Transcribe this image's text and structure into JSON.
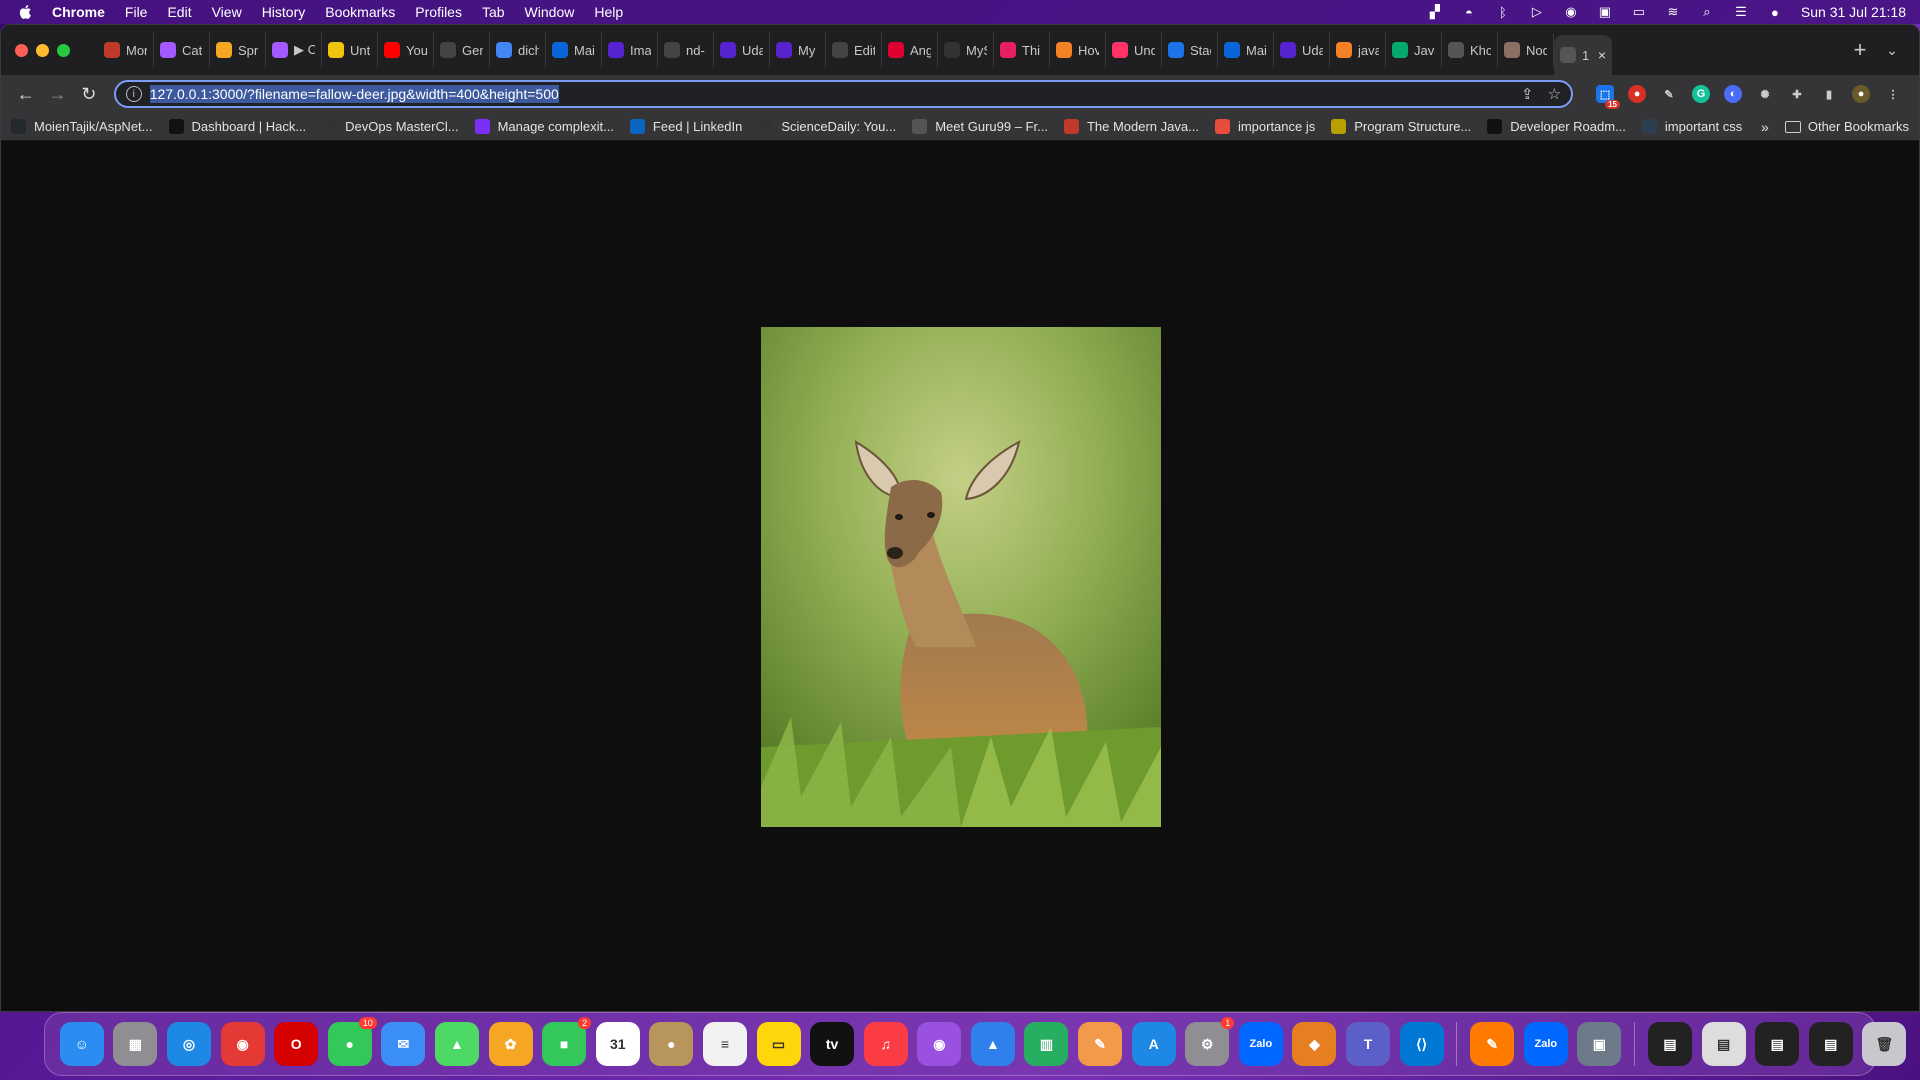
{
  "menubar": {
    "app_name": "Chrome",
    "menus": [
      "File",
      "Edit",
      "View",
      "History",
      "Bookmarks",
      "Profiles",
      "Tab",
      "Window",
      "Help"
    ],
    "clock": "Sun 31 Jul  21:18"
  },
  "tabs": [
    {
      "title": "Mon",
      "icon": "m-icon",
      "color": "#c0392b"
    },
    {
      "title": "Cat",
      "icon": "figma-icon",
      "color": "#a259ff"
    },
    {
      "title": "Spri",
      "icon": "cloud-icon",
      "color": "#f5a623"
    },
    {
      "title": "▶ C",
      "icon": "figma-icon",
      "color": "#a259ff"
    },
    {
      "title": "Unt",
      "icon": "infinity-icon",
      "color": "#f1c40f"
    },
    {
      "title": "You",
      "icon": "youtube-icon",
      "color": "#ff0000"
    },
    {
      "title": "Gen",
      "icon": "github-icon",
      "color": "#444"
    },
    {
      "title": "dich",
      "icon": "google-icon",
      "color": "#4285f4"
    },
    {
      "title": "Mai",
      "icon": "outlook-icon",
      "color": "#0a64d8"
    },
    {
      "title": "Ima",
      "icon": "udemy-icon",
      "color": "#5624d0"
    },
    {
      "title": "nd-",
      "icon": "github-icon",
      "color": "#444"
    },
    {
      "title": "Uda",
      "icon": "udemy-icon",
      "color": "#5624d0"
    },
    {
      "title": "My",
      "icon": "udemy-icon",
      "color": "#5624d0"
    },
    {
      "title": "Edit",
      "icon": "github-icon",
      "color": "#444"
    },
    {
      "title": "Ang",
      "icon": "angular-icon",
      "color": "#dd0031"
    },
    {
      "title": "MyS",
      "icon": "a-icon",
      "color": "#333"
    },
    {
      "title": "Thi",
      "icon": "t-icon",
      "color": "#e91e63"
    },
    {
      "title": "Hov",
      "icon": "stackoverflow-icon",
      "color": "#f48024"
    },
    {
      "title": "Und",
      "icon": "u-icon",
      "color": "#ff3366"
    },
    {
      "title": "Stac",
      "icon": "bolt-icon",
      "color": "#1a73e8"
    },
    {
      "title": "Mai",
      "icon": "outlook-icon",
      "color": "#0a64d8"
    },
    {
      "title": "Uda",
      "icon": "udemy-icon",
      "color": "#5624d0"
    },
    {
      "title": "java",
      "icon": "stackoverflow-icon",
      "color": "#f48024"
    },
    {
      "title": "Java",
      "icon": "w-icon",
      "color": "#04aa6d"
    },
    {
      "title": "Kho",
      "icon": "globe-icon",
      "color": "#555"
    },
    {
      "title": "Nod",
      "icon": "avatar-icon",
      "color": "#8d6e63"
    },
    {
      "title": "1",
      "icon": "globe-icon",
      "color": "#555",
      "active": true
    }
  ],
  "toolbar": {
    "url": "127.0.0.1:3000/?filename=fallow-deer.jpg&width=400&height=500"
  },
  "bookmarks": [
    {
      "label": "MoienTajik/AspNet...",
      "icon": "github-icon",
      "color": "#24292e"
    },
    {
      "label": "Dashboard | Hack...",
      "icon": "hackerrank-icon",
      "color": "#111"
    },
    {
      "label": "DevOps MasterCl...",
      "icon": "devops-icon",
      "color": "#333"
    },
    {
      "label": "Manage complexit...",
      "icon": "d-icon",
      "color": "#7b2ff7"
    },
    {
      "label": "Feed | LinkedIn",
      "icon": "linkedin-icon",
      "color": "#0a66c2"
    },
    {
      "label": "ScienceDaily: You...",
      "icon": "sd-icon",
      "color": "#333"
    },
    {
      "label": "Meet Guru99 – Fr...",
      "icon": "guru-icon",
      "color": "#555"
    },
    {
      "label": "The Modern Java...",
      "icon": "j-icon",
      "color": "#c0392b"
    },
    {
      "label": "importance js",
      "icon": "asterisk-icon",
      "color": "#e74c3c"
    },
    {
      "label": "Program Structure...",
      "icon": "ejs-icon",
      "color": "#b8a000"
    },
    {
      "label": "Developer Roadm...",
      "icon": "roadmap-icon",
      "color": "#111"
    },
    {
      "label": "important css",
      "icon": "k-icon",
      "color": "#2c3e50"
    }
  ],
  "bookmarks_more": "»",
  "other_bookmarks": "Other Bookmarks",
  "image": {
    "alt": "fallow-deer.jpg"
  },
  "dock": [
    {
      "name": "finder",
      "color": "#2b8cf2",
      "glyph": "☺"
    },
    {
      "name": "launchpad",
      "color": "#8e8e93",
      "glyph": "▦"
    },
    {
      "name": "safari",
      "color": "#1e88e5",
      "glyph": "◎"
    },
    {
      "name": "chrome",
      "color": "#e53935",
      "glyph": "◉"
    },
    {
      "name": "opera",
      "color": "#d50000",
      "glyph": "O"
    },
    {
      "name": "messages",
      "color": "#34c759",
      "glyph": "●",
      "badge": "10"
    },
    {
      "name": "mail",
      "color": "#3a8ef6",
      "glyph": "✉"
    },
    {
      "name": "maps",
      "color": "#4cd964",
      "glyph": "▲"
    },
    {
      "name": "photos",
      "color": "#f5a623",
      "glyph": "✿"
    },
    {
      "name": "facetime",
      "color": "#34c759",
      "glyph": "■",
      "badge": "2"
    },
    {
      "name": "calendar",
      "color": "#ffffff",
      "glyph": "31"
    },
    {
      "name": "contacts",
      "color": "#b8955a",
      "glyph": "●"
    },
    {
      "name": "reminders",
      "color": "#f2f2f2",
      "glyph": "≡"
    },
    {
      "name": "notes",
      "color": "#ffd60a",
      "glyph": "▭"
    },
    {
      "name": "appletv",
      "color": "#111111",
      "glyph": "tv"
    },
    {
      "name": "music",
      "color": "#fc3c44",
      "glyph": "♫"
    },
    {
      "name": "podcasts",
      "color": "#9b51e0",
      "glyph": "◉"
    },
    {
      "name": "keynote",
      "color": "#2f80ed",
      "glyph": "▲"
    },
    {
      "name": "numbers",
      "color": "#27ae60",
      "glyph": "▥"
    },
    {
      "name": "pages",
      "color": "#f2994a",
      "glyph": "✎"
    },
    {
      "name": "appstore",
      "color": "#1e88e5",
      "glyph": "A"
    },
    {
      "name": "system-preferences",
      "color": "#8e8e93",
      "glyph": "⚙",
      "badge": "1"
    },
    {
      "name": "zalo",
      "color": "#0068ff",
      "glyph": "Zalo"
    },
    {
      "name": "box-app",
      "color": "#e67e22",
      "glyph": "◆"
    },
    {
      "name": "teams",
      "color": "#5b5fc7",
      "glyph": "T"
    },
    {
      "name": "vscode",
      "color": "#0078d4",
      "glyph": "⟨⟩"
    },
    {
      "name": "sep"
    },
    {
      "name": "pen-app",
      "color": "#ff7a00",
      "glyph": "✎"
    },
    {
      "name": "zalo-2",
      "color": "#0068ff",
      "glyph": "Zalo"
    },
    {
      "name": "screenshot-app",
      "color": "#6c7a89",
      "glyph": "▣"
    },
    {
      "name": "sep"
    },
    {
      "name": "window-thumb-1",
      "color": "#222",
      "glyph": "▤"
    },
    {
      "name": "window-thumb-2",
      "color": "#ddd",
      "glyph": "▤"
    },
    {
      "name": "window-thumb-3",
      "color": "#222",
      "glyph": "▤"
    },
    {
      "name": "window-thumb-4",
      "color": "#222",
      "glyph": "▤"
    },
    {
      "name": "trash",
      "color": "#c7c7cc",
      "glyph": "🗑"
    }
  ]
}
